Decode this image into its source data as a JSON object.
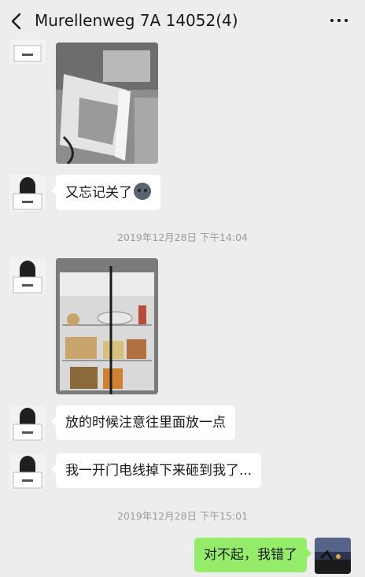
{
  "header": {
    "title": "Murellenweg 7A 14052(4)"
  },
  "messages": {
    "msg1": {
      "text": "又忘记关了"
    },
    "ts1": "2019年12月28日 下午14:04",
    "msg2": {
      "text": "放的时候注意往里面放一点"
    },
    "msg3": {
      "text": "我一开门电线掉下来砸到我了..."
    },
    "ts2": "2019年12月28日 下午15:01",
    "msg4": {
      "text": "对不起，我错了"
    }
  },
  "colors": {
    "self_bubble": "#95ec69",
    "other_bubble": "#ffffff",
    "background": "#ededed"
  },
  "icons": {
    "back": "back-arrow-icon",
    "more": "more-dots-icon",
    "emoji": "sad-face-emoji-icon"
  }
}
